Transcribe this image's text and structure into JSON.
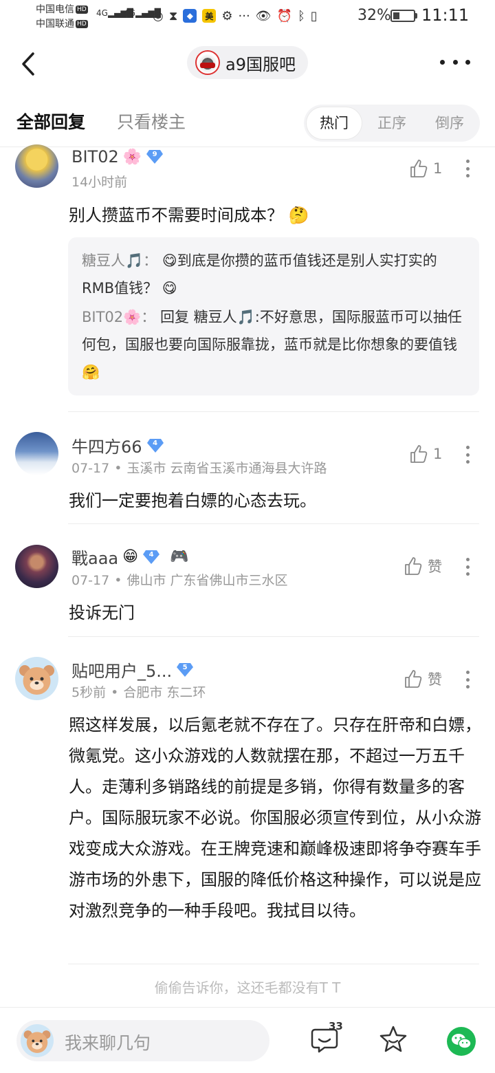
{
  "status_bar": {
    "carrier1": "中国电信",
    "carrier2": "中国联通",
    "hd": "HD",
    "net1": "4G",
    "net2": "4G",
    "mei": "美",
    "dots": "···",
    "battery": "32%",
    "time": "11:11"
  },
  "header": {
    "forum_name": "a9国服吧"
  },
  "filters": {
    "all_replies": "全部回复",
    "owner_only": "只看楼主",
    "sort_hot": "热门",
    "sort_asc": "正序",
    "sort_desc": "倒序"
  },
  "posts": [
    {
      "username": "BIT02",
      "name_emoji": "🌸",
      "level": "9",
      "meta": "14小时前",
      "like": "1",
      "content": "别人攒蓝币不需要时间成本？ 🤔",
      "quotes": [
        {
          "name": "糖豆人🎵：",
          "text": " 😋到底是你攒的蓝币值钱还是别人实打实的RMB值钱？ 😋"
        },
        {
          "name": "BIT02🌸：",
          "text": " 回复 糖豆人🎵:不好意思，国际服蓝币可以抽任何包，国服也要向国际服靠拢，蓝币就是比你想象的要值钱 🤗"
        }
      ]
    },
    {
      "username": "牛四方66",
      "level": "4",
      "date": "07-17",
      "location": "玉溪市 云南省玉溪市通海县大许路",
      "like": "1",
      "content": "我们一定要抱着白嫖的心态去玩。"
    },
    {
      "username": "戰aaa",
      "name_emoji": "😁",
      "level": "4",
      "game_emoji": "🎮",
      "date": "07-17",
      "location": "佛山市 广东省佛山市三水区",
      "like": "赞",
      "content": "投诉无门"
    },
    {
      "username": "贴吧用户_5...",
      "level": "5",
      "date": "5秒前",
      "location": "合肥市 东二环",
      "like": "赞",
      "content": "照这样发展，以后氪老就不存在了。只存在肝帝和白嫖，微氪党。这小众游戏的人数就摆在那，不超过一万五千人。走薄利多销路线的前提是多销，你得有数量多的客户。国际服玩家不必说。你国服必须宣传到位，从小众游戏变成大众游戏。在王牌竞速和巅峰极速即将争夺赛车手游市场的外患下，国服的降低价格这种操作，可以说是应对激烈竞争的一种手段吧。我拭目以待。"
    }
  ],
  "footer_note": "偷偷告诉你，这还毛都没有T T",
  "bottom_bar": {
    "placeholder": "我来聊几句",
    "comment_count": "33"
  },
  "colors": {
    "level_badge": "#5b9cf5",
    "wechat": "#1db954",
    "muted_text": "#999999"
  }
}
